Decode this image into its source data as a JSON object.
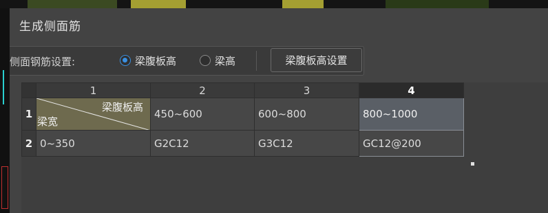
{
  "dialog": {
    "title": "生成侧面筋"
  },
  "toolbar": {
    "setting_label": "侧面钢筋设置:",
    "radio_options": [
      {
        "label": "梁腹板高",
        "selected": true
      },
      {
        "label": "梁高",
        "selected": false
      }
    ],
    "settings_button": "梁腹板高设置"
  },
  "grid": {
    "column_headers": [
      "1",
      "2",
      "3",
      "4"
    ],
    "row_headers": [
      "1",
      "2"
    ],
    "selected_column": "4",
    "header_cell": {
      "top_label": "梁腹板高",
      "bottom_label": "梁宽"
    },
    "rows": [
      [
        "",
        "450~600",
        "600~800",
        "800~1000"
      ],
      [
        "0~350",
        "G2C12",
        "G3C12",
        "GC12@200"
      ]
    ]
  },
  "colors": {
    "accent": "#3a8fe0",
    "header_cell_bg": "#6e6a4e",
    "selected_cell_bg": "#5a5f66"
  }
}
